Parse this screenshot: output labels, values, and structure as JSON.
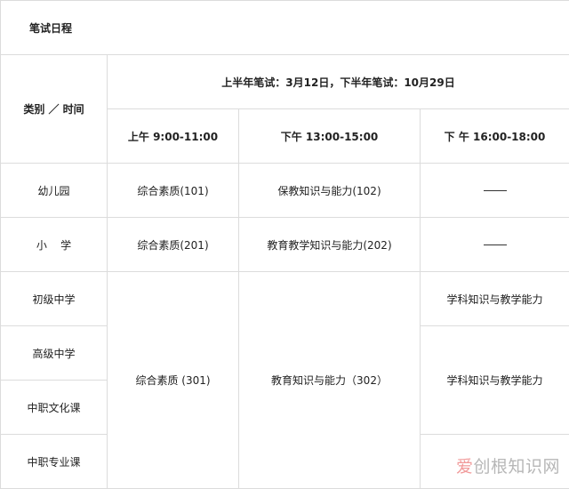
{
  "title": "笔试日程",
  "header": {
    "category_time": "类别 ／ 时间",
    "dates": "上半年笔试：3月12日，下半年笔试：10月29日",
    "sessions": [
      "上午  9:00-11:00",
      "下午  13:00-15:00",
      "下 午  16:00-18:00"
    ]
  },
  "rows": [
    {
      "category": "幼儿园",
      "s1": "综合素质(101)",
      "s2": "保教知识与能力(102)"
    },
    {
      "category": "小    学",
      "s1": "综合素质(201)",
      "s2": "教育教学知识与能力(202)"
    },
    {
      "category": "初级中学",
      "s3": "学科知识与教学能力"
    },
    {
      "category": "高级中学"
    },
    {
      "category": "中职文化课"
    },
    {
      "category": "中职专业课"
    }
  ],
  "merged": {
    "s1": "综合素质 (301)",
    "s2": "教育知识与能力（302）",
    "s3_high": "学科知识与教学能力"
  },
  "watermark": {
    "accent": "爱",
    "rest": "创根知识网"
  }
}
